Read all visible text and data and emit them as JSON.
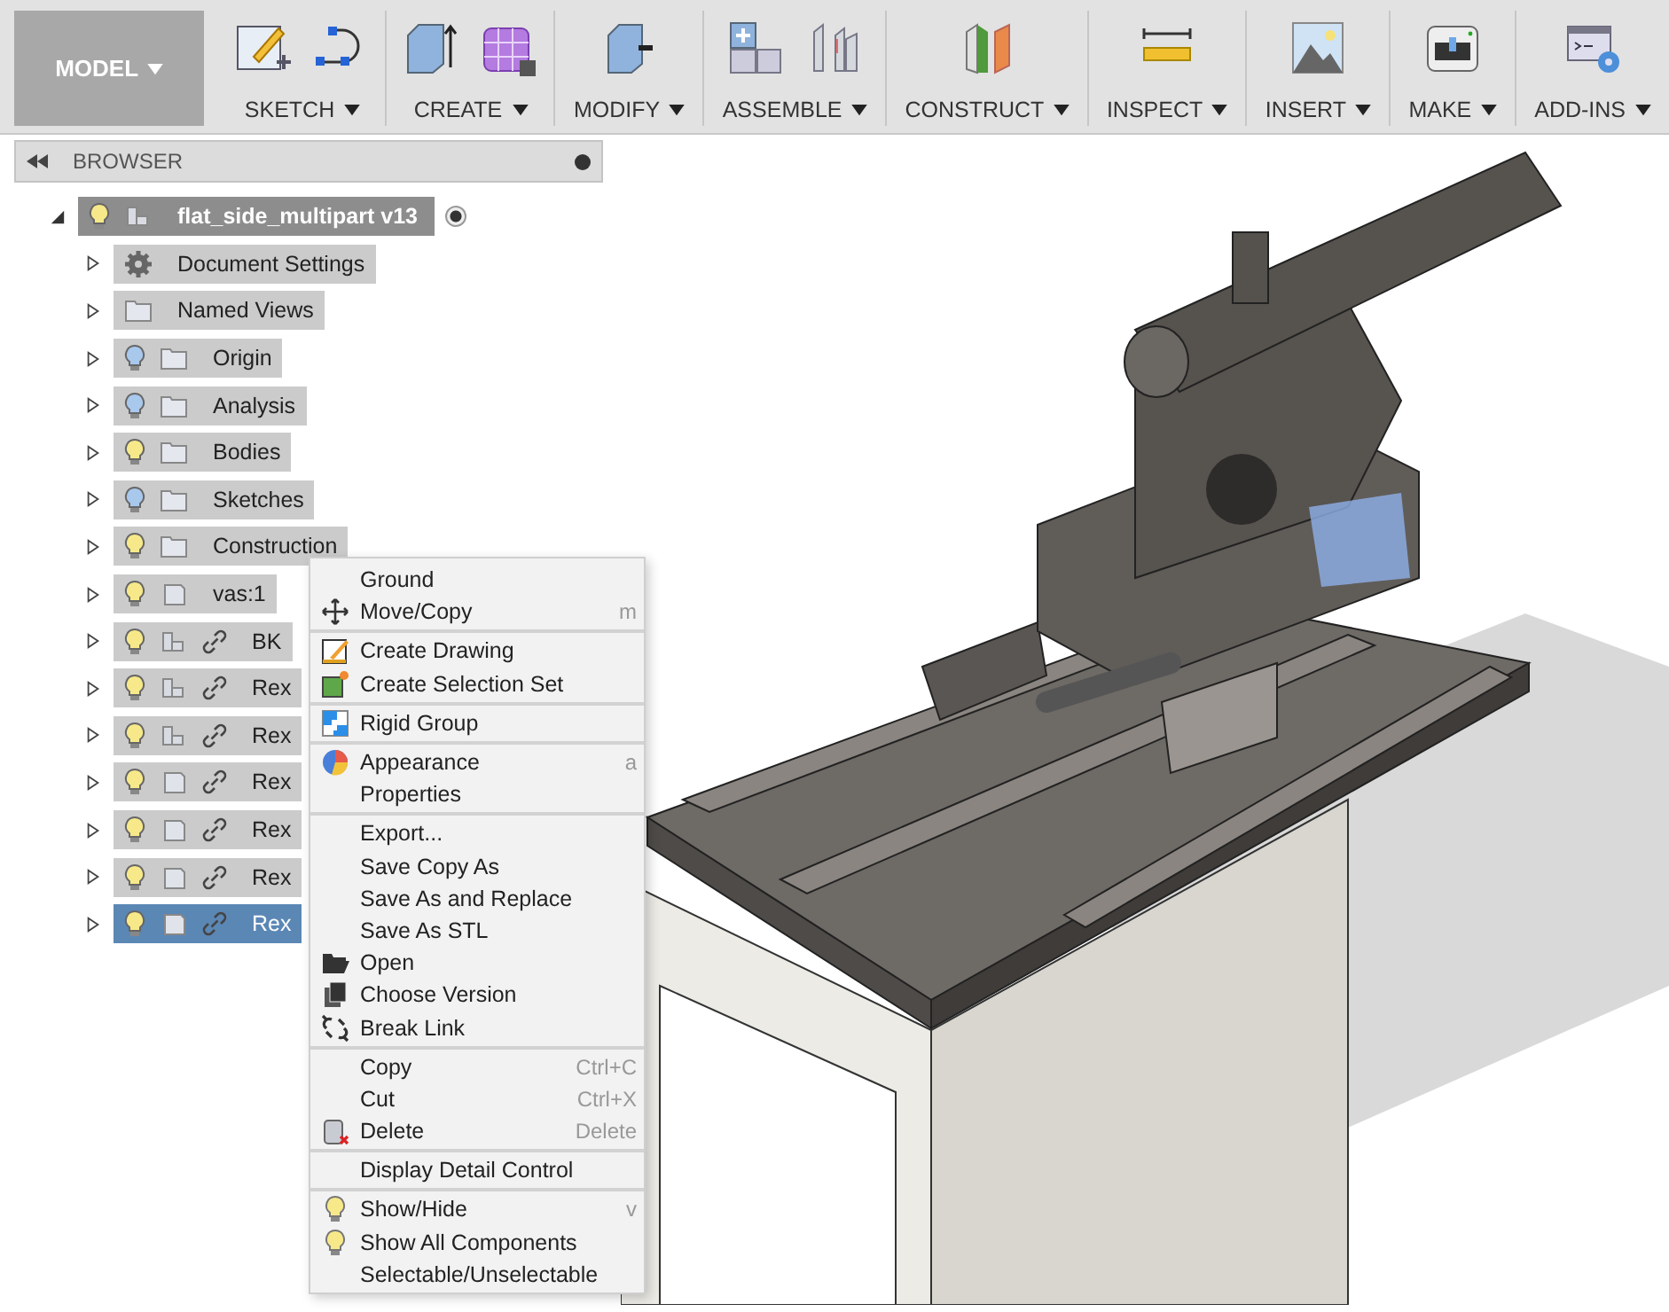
{
  "toolbar": {
    "workspace": "MODEL",
    "groups": [
      {
        "label": "SKETCH"
      },
      {
        "label": "CREATE"
      },
      {
        "label": "MODIFY"
      },
      {
        "label": "ASSEMBLE"
      },
      {
        "label": "CONSTRUCT"
      },
      {
        "label": "INSPECT"
      },
      {
        "label": "INSERT"
      },
      {
        "label": "MAKE"
      },
      {
        "label": "ADD-INS"
      }
    ]
  },
  "browser": {
    "title": "BROWSER",
    "root": {
      "label": "flat_side_multipart v13",
      "expanded": true,
      "visible": true,
      "active": true,
      "children": [
        {
          "kind": "settings",
          "label": "Document Settings",
          "expanded": false,
          "selected": false
        },
        {
          "kind": "folder",
          "label": "Named Views",
          "expanded": false,
          "selected": false
        },
        {
          "kind": "folder",
          "label": "Origin",
          "visible": false,
          "expanded": false,
          "selected": false
        },
        {
          "kind": "folder",
          "label": "Analysis",
          "visible": false,
          "expanded": false,
          "selected": false
        },
        {
          "kind": "folder",
          "label": "Bodies",
          "visible": true,
          "expanded": false,
          "selected": false
        },
        {
          "kind": "folder",
          "label": "Sketches",
          "visible": false,
          "expanded": false,
          "selected": false
        },
        {
          "kind": "folder",
          "label": "Construction",
          "visible": true,
          "expanded": false,
          "selected": false
        },
        {
          "kind": "body",
          "label": "vas:1",
          "visible": true,
          "linked": false,
          "expanded": false,
          "selected": false
        },
        {
          "kind": "component",
          "label": "BK",
          "visible": true,
          "linked": true,
          "expanded": false,
          "selected": false
        },
        {
          "kind": "component",
          "label": "Rex",
          "visible": true,
          "linked": true,
          "expanded": false,
          "selected": false
        },
        {
          "kind": "component",
          "label": "Rex",
          "visible": true,
          "linked": true,
          "expanded": false,
          "selected": false
        },
        {
          "kind": "body",
          "label": "Rex",
          "visible": true,
          "linked": true,
          "expanded": false,
          "selected": false
        },
        {
          "kind": "body",
          "label": "Rex",
          "visible": true,
          "linked": true,
          "expanded": false,
          "selected": false
        },
        {
          "kind": "body",
          "label": "Rex",
          "visible": true,
          "linked": true,
          "expanded": false,
          "selected": false
        },
        {
          "kind": "body",
          "label": "Rex",
          "visible": true,
          "linked": true,
          "expanded": false,
          "selected": true
        }
      ]
    }
  },
  "context_menu": {
    "sections": [
      [
        {
          "label": "Ground"
        },
        {
          "label": "Move/Copy",
          "shortcut": "m"
        }
      ],
      [
        {
          "label": "Create Drawing"
        },
        {
          "label": "Create Selection Set"
        }
      ],
      [
        {
          "label": "Rigid Group"
        }
      ],
      [
        {
          "label": "Appearance",
          "shortcut": "a"
        },
        {
          "label": "Properties"
        }
      ],
      [
        {
          "label": "Export..."
        },
        {
          "label": "Save Copy As"
        },
        {
          "label": "Save As and Replace"
        },
        {
          "label": "Save As STL"
        },
        {
          "label": "Open"
        },
        {
          "label": "Choose Version"
        },
        {
          "label": "Break Link"
        }
      ],
      [
        {
          "label": "Copy",
          "shortcut": "Ctrl+C"
        },
        {
          "label": "Cut",
          "shortcut": "Ctrl+X"
        },
        {
          "label": "Delete",
          "shortcut": "Delete"
        }
      ],
      [
        {
          "label": "Display Detail Control"
        }
      ],
      [
        {
          "label": "Show/Hide",
          "shortcut": "v"
        },
        {
          "label": "Show All Components"
        },
        {
          "label": "Selectable/Unselectable"
        }
      ]
    ]
  }
}
